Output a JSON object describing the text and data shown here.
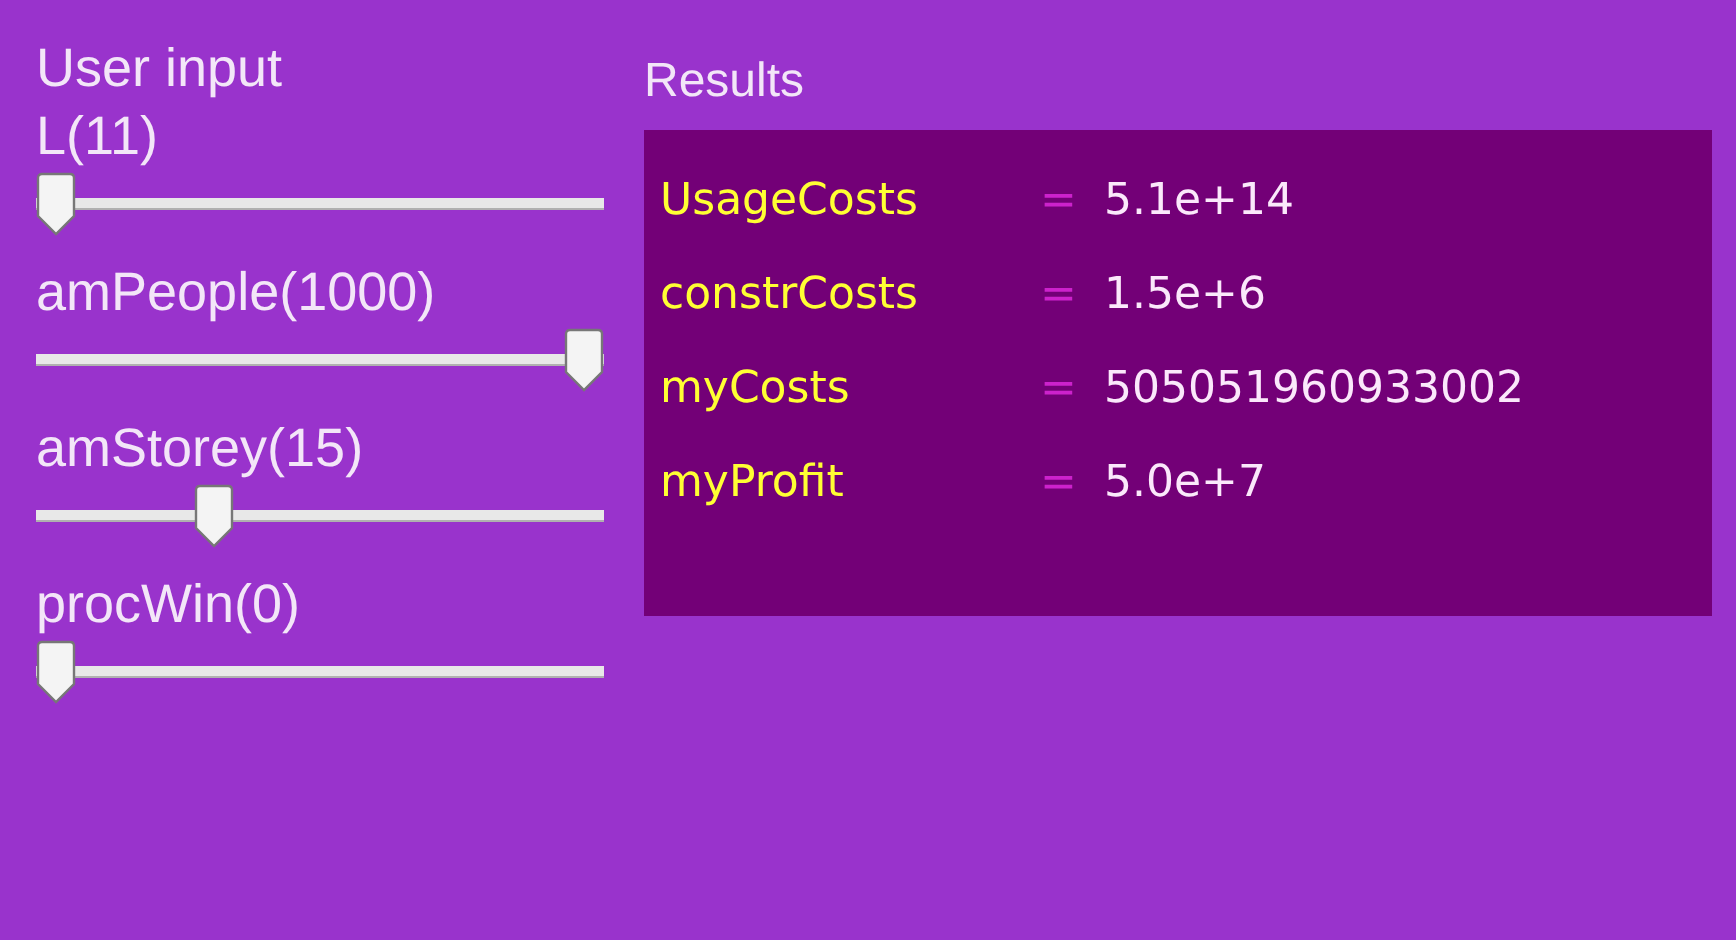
{
  "inputs": {
    "title": "User input",
    "sliders": [
      {
        "label": "L(11)",
        "level": 0.0
      },
      {
        "label": "amPeople(1000)",
        "level": 1.0
      },
      {
        "label": "amStorey(15)",
        "level": 0.3
      },
      {
        "label": "procWin(0)",
        "level": 0.0
      }
    ]
  },
  "results": {
    "title": "Results",
    "rows": [
      {
        "name": "UsageCosts",
        "sign": "=",
        "value": "5.1e+14"
      },
      {
        "name": "constrCosts",
        "sign": "=",
        "value": "1.5e+6"
      },
      {
        "name": "myCosts",
        "sign": "=",
        "value": "505051960933002"
      },
      {
        "name": "myProfit",
        "sign": "=",
        "value": "5.0e+7"
      }
    ]
  }
}
